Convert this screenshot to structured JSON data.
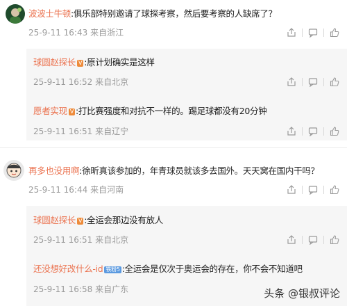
{
  "comments": [
    {
      "user": "波波士牛顿",
      "text": ":俱乐部特别邀请了球探考察，然后要考察的人缺席了？",
      "time": "25-9-11 16:43",
      "location": "来自浙江",
      "replies": [
        {
          "user": "球圆赵探长",
          "tag": "V",
          "text": ":原计划确实是这样",
          "time": "25-9-11 16:52",
          "location": "来自北京"
        },
        {
          "user": "愿者实现",
          "tag": "V",
          "text": ":打比赛强度和对抗不一样的。踢足球都没有20分钟",
          "time": "25-9-11 16:51",
          "location": "来自辽宁"
        }
      ]
    },
    {
      "user": "再多也没用啊",
      "text": ":徐昕真该参加的，年青球员就该多去国外。天天窝在国内干吗？",
      "time": "25-9-11 16:44",
      "location": "来自河南",
      "replies": [
        {
          "user": "球圆赵探长",
          "tag": "V",
          "text": ":全运会那边没有放人",
          "time": "25-9-11 16:51",
          "location": "来自北京"
        },
        {
          "user": "还没想好改什么-id",
          "tag": "铁粉5",
          "text": ":全运会是仅次于奥运会的存在，你不会不知道吧",
          "time": "25-9-11 16:58",
          "location": "来自广东"
        }
      ]
    }
  ],
  "watermark": {
    "platform": "头条",
    "author": "@银叔评论"
  },
  "icons": {
    "share": "share-icon",
    "comment": "comment-icon",
    "like": "like-icon"
  }
}
